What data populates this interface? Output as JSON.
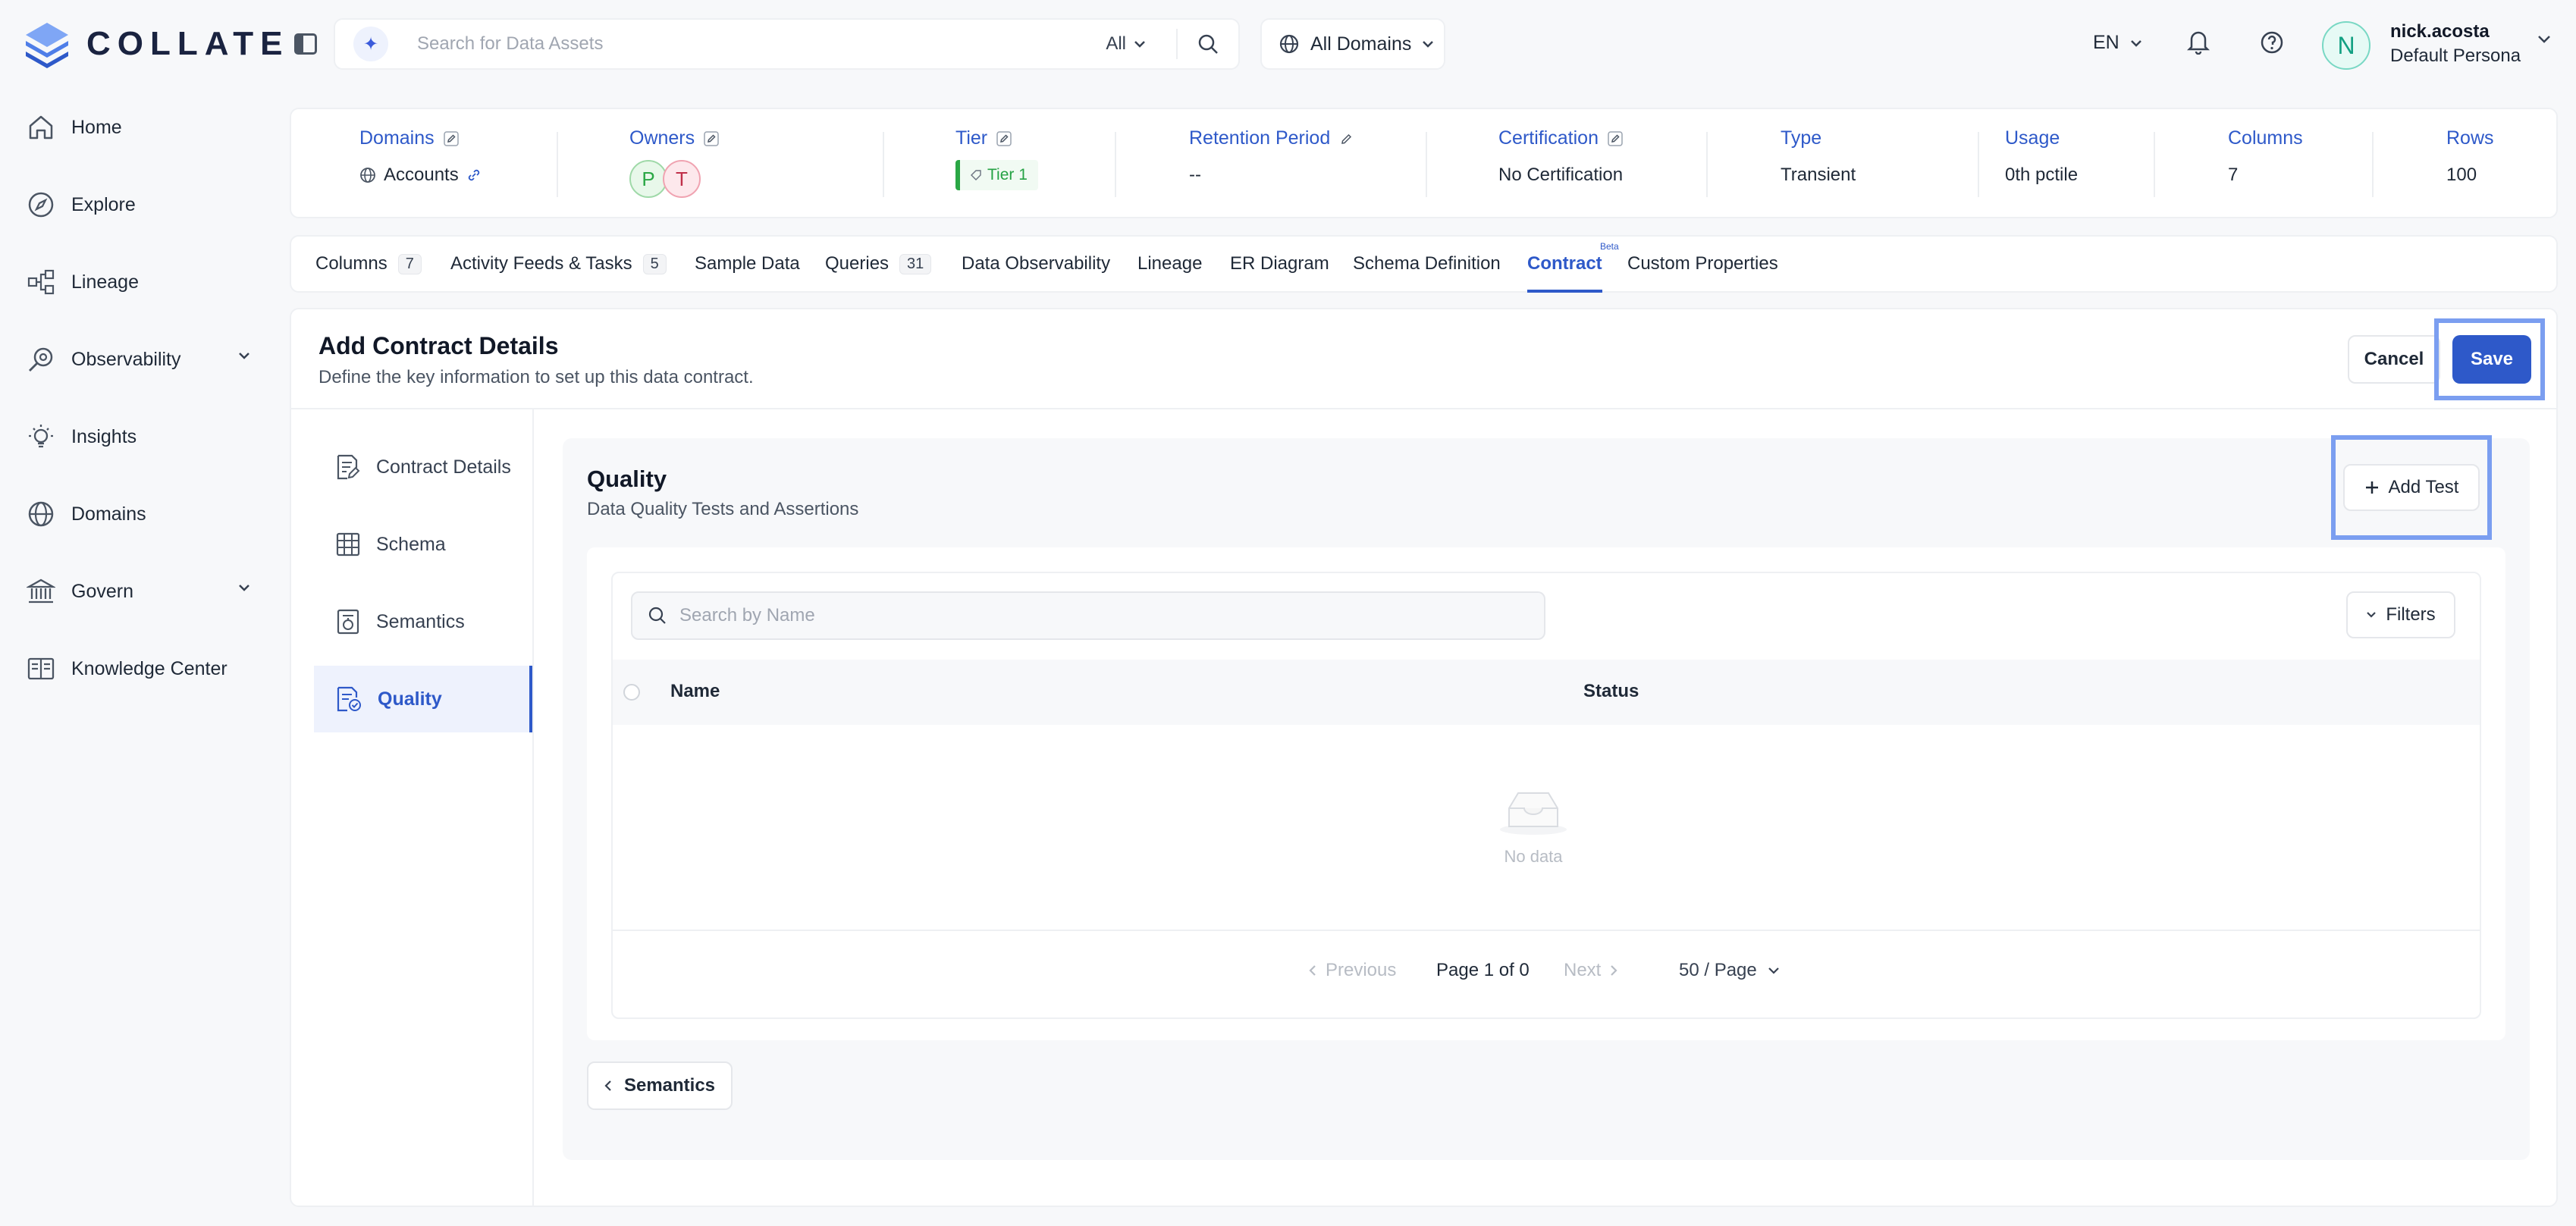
{
  "brand": {
    "name": "COLLATE"
  },
  "search": {
    "placeholder": "Search for Data Assets",
    "scope": "All"
  },
  "domain_select": {
    "label": "All Domains"
  },
  "header": {
    "language": "EN"
  },
  "user": {
    "initial": "N",
    "name": "nick.acosta",
    "persona": "Default Persona"
  },
  "nav": {
    "items": [
      {
        "label": "Home",
        "icon": "home-icon"
      },
      {
        "label": "Explore",
        "icon": "compass-icon"
      },
      {
        "label": "Lineage",
        "icon": "lineage-icon"
      },
      {
        "label": "Observability",
        "icon": "observability-icon"
      },
      {
        "label": "Insights",
        "icon": "lightbulb-icon"
      },
      {
        "label": "Domains",
        "icon": "globe-icon"
      },
      {
        "label": "Govern",
        "icon": "bank-icon"
      },
      {
        "label": "Knowledge Center",
        "icon": "book-icon"
      }
    ]
  },
  "info": {
    "domains_label": "Domains",
    "domains_value": "Accounts",
    "owners_label": "Owners",
    "owners": [
      "P",
      "T"
    ],
    "tier_label": "Tier",
    "tier_value": "Tier 1",
    "retention_label": "Retention Period",
    "retention_value": "--",
    "cert_label": "Certification",
    "cert_value": "No Certification",
    "type_label": "Type",
    "type_value": "Transient",
    "usage_label": "Usage",
    "usage_value": "0th pctile",
    "columns_label": "Columns",
    "columns_value": "7",
    "rows_label": "Rows",
    "rows_value": "100"
  },
  "tabs": [
    {
      "label": "Columns",
      "count": "7"
    },
    {
      "label": "Activity Feeds & Tasks",
      "count": "5"
    },
    {
      "label": "Sample Data"
    },
    {
      "label": "Queries",
      "count": "31"
    },
    {
      "label": "Data Observability"
    },
    {
      "label": "Lineage"
    },
    {
      "label": "ER Diagram"
    },
    {
      "label": "Schema Definition"
    },
    {
      "label": "Contract",
      "badge": "Beta"
    },
    {
      "label": "Custom Properties"
    }
  ],
  "contract": {
    "title": "Add Contract Details",
    "subtitle": "Define the key information to set up this data contract.",
    "cancel_label": "Cancel",
    "save_label": "Save",
    "steps": [
      {
        "label": "Contract Details"
      },
      {
        "label": "Schema"
      },
      {
        "label": "Semantics"
      },
      {
        "label": "Quality"
      }
    ]
  },
  "quality": {
    "title": "Quality",
    "subtitle": "Data Quality Tests and Assertions",
    "add_test_label": "Add Test",
    "search_placeholder": "Search by Name",
    "filters_label": "Filters",
    "columns": [
      "Name",
      "Status"
    ],
    "empty_text": "No data",
    "pager": {
      "prev": "Previous",
      "info": "Page 1 of 0",
      "next": "Next",
      "size": "50 / Page"
    },
    "back_label": "Semantics"
  },
  "colors": {
    "accent": "#2e59c9",
    "highlight": "#7b9ef0",
    "tier": "#2aa745"
  }
}
